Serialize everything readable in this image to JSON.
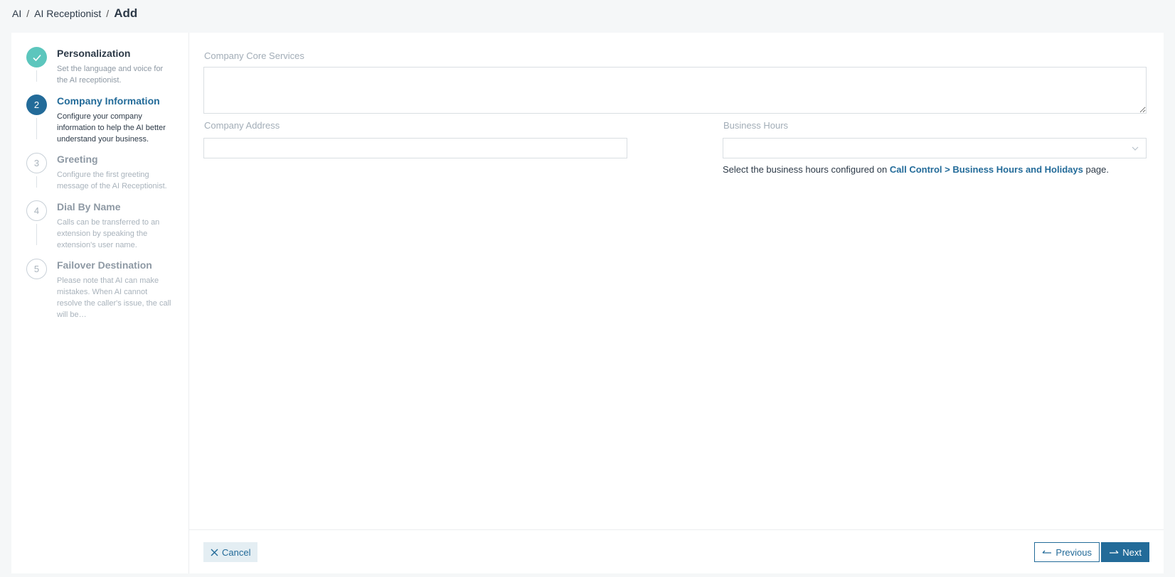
{
  "breadcrumb": {
    "items": [
      "AI",
      "AI Receptionist"
    ],
    "separator": "/",
    "current": "Add"
  },
  "steps": [
    {
      "number": "1",
      "title": "Personalization",
      "description": "Set the language and voice for the AI receptionist.",
      "state": "done",
      "icon": "check-icon"
    },
    {
      "number": "2",
      "title": "Company Information",
      "description": "Configure your company information to help the AI better understand your business.",
      "state": "active"
    },
    {
      "number": "3",
      "title": "Greeting",
      "description": "Configure the first greeting message of the AI Receptionist.",
      "state": "pending"
    },
    {
      "number": "4",
      "title": "Dial By Name",
      "description": "Calls can be transferred to an extension by speaking the extension's user name.",
      "state": "pending"
    },
    {
      "number": "5",
      "title": "Failover Destination",
      "description": "Please note that AI can make mistakes. When AI cannot resolve the caller's issue, the call will be…",
      "state": "pending"
    }
  ],
  "form": {
    "core_services_label": "Company Core Services",
    "core_services_value": "",
    "address_label": "Company Address",
    "address_value": "",
    "business_hours_label": "Business Hours",
    "business_hours_value": "",
    "hint_prefix": "Select the business hours configured on ",
    "hint_link": "Call Control > Business Hours and Holidays",
    "hint_suffix": " page."
  },
  "footer": {
    "cancel_label": "Cancel",
    "previous_label": "Previous",
    "next_label": "Next"
  },
  "colors": {
    "accent": "#236b99",
    "done": "#5cc6bd"
  }
}
